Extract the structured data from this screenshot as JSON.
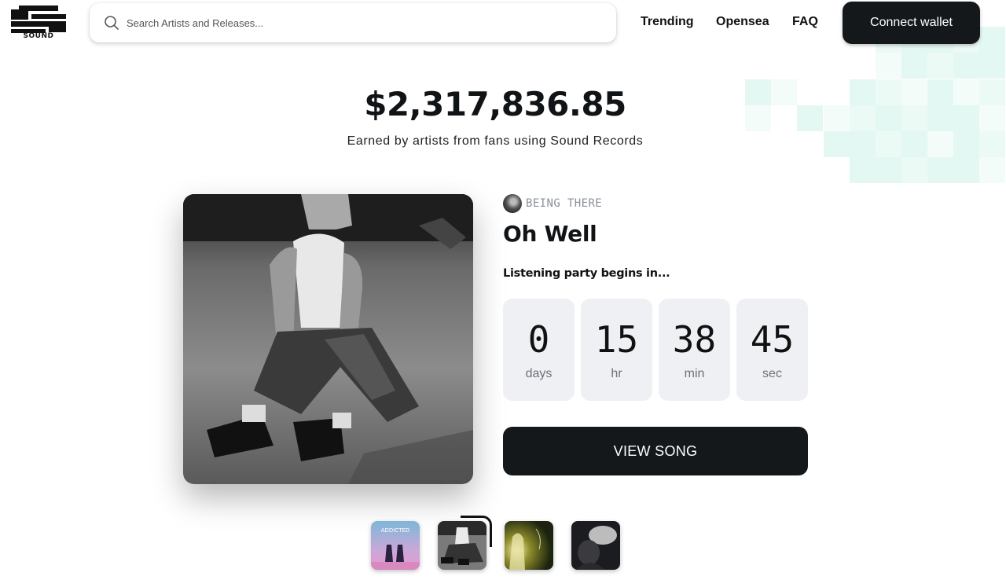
{
  "header": {
    "logo_text": "SOUND",
    "search_placeholder": "Search Artists and Releases...",
    "nav": [
      "Trending",
      "Opensea",
      "FAQ"
    ],
    "connect_label": "Connect wallet"
  },
  "hero": {
    "earned_amount": "$2,317,836.85",
    "earned_caption": "Earned by artists from fans using Sound Records"
  },
  "release": {
    "artist": "BEING THERE",
    "title": "Oh Well",
    "party_label": "Listening party begins in...",
    "countdown": [
      {
        "value": "0",
        "unit": "days"
      },
      {
        "value": "15",
        "unit": "hr"
      },
      {
        "value": "38",
        "unit": "min"
      },
      {
        "value": "45",
        "unit": "sec"
      }
    ],
    "view_label": "VIEW SONG"
  },
  "thumbnails": {
    "first_cover_text": "ADDICTED",
    "selected_index": 1
  },
  "colors": {
    "primary": "#15181b",
    "countdown_bg": "#eef0f3",
    "pixel_accent": "#e3f8f2"
  }
}
